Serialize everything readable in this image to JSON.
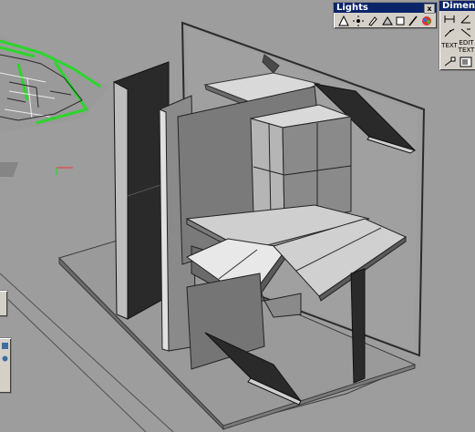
{
  "lights_palette": {
    "title": "Lights",
    "close_glyph": "x",
    "tools": [
      {
        "name": "point-light-icon"
      },
      {
        "name": "spot-light-icon"
      },
      {
        "name": "distant-light-icon"
      },
      {
        "name": "background-icon"
      },
      {
        "name": "render-icon"
      },
      {
        "name": "materials-icon"
      }
    ]
  },
  "dimension_palette": {
    "title": "Dimension",
    "text_label": "TEXT",
    "edit_text_label": "EDIT\nTEXT"
  },
  "colors": {
    "viewport_bg": "#9d9d9d",
    "panel_dark": "#2a2a2a",
    "panel_mid": "#7f7f7f",
    "panel_light": "#e6e6e6",
    "floor_plan_green": "#2bd62b"
  }
}
